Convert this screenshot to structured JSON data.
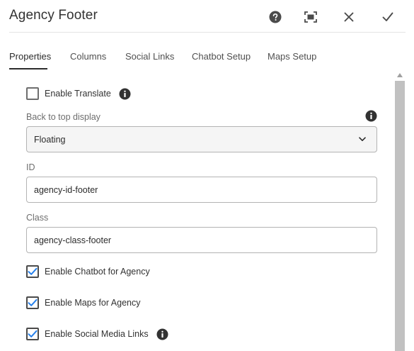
{
  "header": {
    "title": "Agency Footer",
    "help_icon": "help-circle-icon",
    "fullscreen_icon": "fullscreen-icon",
    "close_icon": "close-icon",
    "done_icon": "checkmark-icon"
  },
  "tabs": [
    {
      "label": "Properties",
      "active": true
    },
    {
      "label": "Columns",
      "active": false
    },
    {
      "label": "Social Links",
      "active": false
    },
    {
      "label": "Chatbot Setup",
      "active": false
    },
    {
      "label": "Maps Setup",
      "active": false
    }
  ],
  "form": {
    "enable_translate": {
      "label": "Enable Translate",
      "checked": false
    },
    "back_to_top": {
      "label": "Back to top display",
      "value": "Floating"
    },
    "id_field": {
      "label": "ID",
      "value": "agency-id-footer"
    },
    "class_field": {
      "label": "Class",
      "value": "agency-class-footer"
    },
    "enable_chatbot": {
      "label": "Enable Chatbot for Agency",
      "checked": true
    },
    "enable_maps": {
      "label": "Enable Maps for Agency",
      "checked": true
    },
    "enable_social": {
      "label": "Enable Social Media Links",
      "checked": true
    }
  },
  "colors": {
    "accent": "#2c2c2c",
    "checkmark": "#2680eb",
    "border": "#b3b3b3",
    "scrollbar": "#c1c1c1"
  }
}
